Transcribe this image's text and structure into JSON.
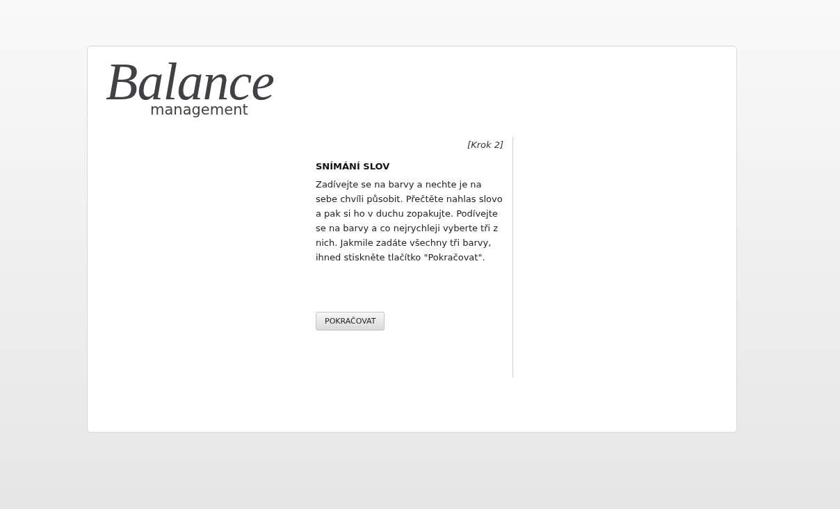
{
  "logo": {
    "wordmark": "Balance",
    "tagline": "management"
  },
  "step": "[Krok 2]",
  "heading": "SNÍMÁNÍ SLOV",
  "instructions": "Zadívejte se na barvy a nechte je na sebe chvíli působit. Přečtěte nahlas slovo a pak si ho v duchu zopakujte. Podívejte se na barvy a co nejrychleji vyberte tři z nich. Jakmile zadáte všechny tři barvy, ihned stiskněte tlačítko \"Pokračovat\".",
  "buttons": [
    "POKRAČOVAT"
  ]
}
